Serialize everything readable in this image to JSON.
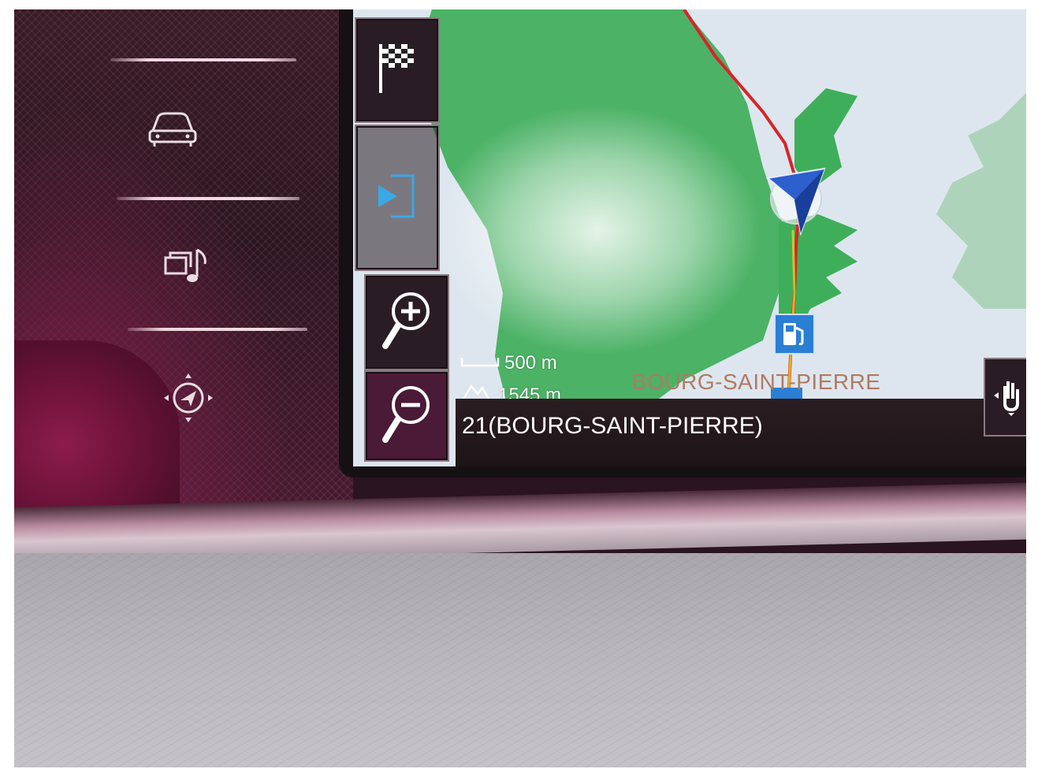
{
  "console": {
    "items": [
      {
        "name": "vehicle",
        "icon": "car-icon"
      },
      {
        "name": "media",
        "icon": "media-music-icon"
      },
      {
        "name": "navigation",
        "icon": "navigation-arrow-icon"
      }
    ]
  },
  "map": {
    "buttons": [
      {
        "name": "destination",
        "icon": "checkered-flag-icon"
      },
      {
        "name": "side-panel",
        "icon": "panel-open-icon"
      },
      {
        "name": "zoom-in",
        "icon": "zoom-in-icon"
      },
      {
        "name": "zoom-out",
        "icon": "zoom-out-icon"
      }
    ],
    "scale_text": "500 m",
    "altitude_text": "1545 m",
    "town_label": "BOURG-SAINT-PIERRE",
    "status_text": "21(BOURG-SAINT-PIERRE)",
    "colors": {
      "forest": "#3fae5a",
      "route": "#d8232a",
      "poi": "#2a7fd4",
      "status_bar": "#2b1d22"
    }
  }
}
